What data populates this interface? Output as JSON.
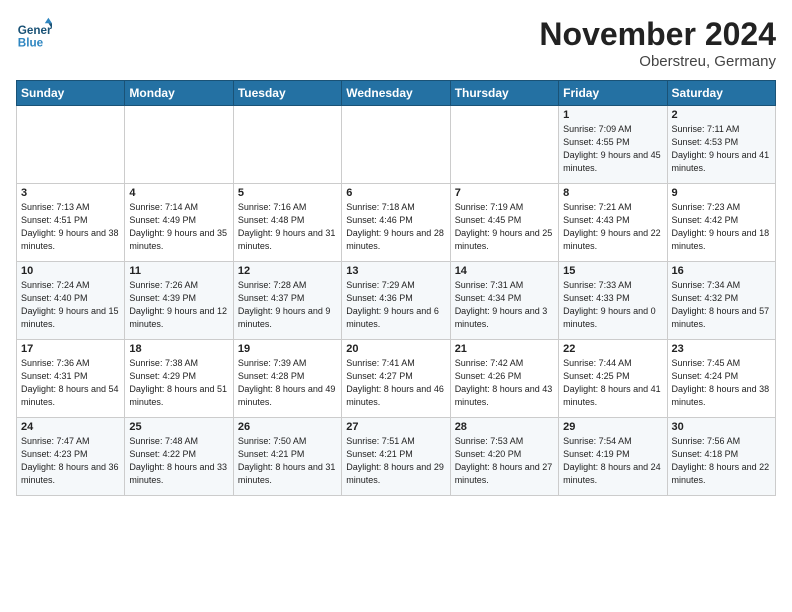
{
  "logo": {
    "line1": "General",
    "line2": "Blue"
  },
  "header": {
    "month": "November 2024",
    "location": "Oberstreu, Germany"
  },
  "weekdays": [
    "Sunday",
    "Monday",
    "Tuesday",
    "Wednesday",
    "Thursday",
    "Friday",
    "Saturday"
  ],
  "weeks": [
    [
      {
        "day": "",
        "info": ""
      },
      {
        "day": "",
        "info": ""
      },
      {
        "day": "",
        "info": ""
      },
      {
        "day": "",
        "info": ""
      },
      {
        "day": "",
        "info": ""
      },
      {
        "day": "1",
        "info": "Sunrise: 7:09 AM\nSunset: 4:55 PM\nDaylight: 9 hours\nand 45 minutes."
      },
      {
        "day": "2",
        "info": "Sunrise: 7:11 AM\nSunset: 4:53 PM\nDaylight: 9 hours\nand 41 minutes."
      }
    ],
    [
      {
        "day": "3",
        "info": "Sunrise: 7:13 AM\nSunset: 4:51 PM\nDaylight: 9 hours\nand 38 minutes."
      },
      {
        "day": "4",
        "info": "Sunrise: 7:14 AM\nSunset: 4:49 PM\nDaylight: 9 hours\nand 35 minutes."
      },
      {
        "day": "5",
        "info": "Sunrise: 7:16 AM\nSunset: 4:48 PM\nDaylight: 9 hours\nand 31 minutes."
      },
      {
        "day": "6",
        "info": "Sunrise: 7:18 AM\nSunset: 4:46 PM\nDaylight: 9 hours\nand 28 minutes."
      },
      {
        "day": "7",
        "info": "Sunrise: 7:19 AM\nSunset: 4:45 PM\nDaylight: 9 hours\nand 25 minutes."
      },
      {
        "day": "8",
        "info": "Sunrise: 7:21 AM\nSunset: 4:43 PM\nDaylight: 9 hours\nand 22 minutes."
      },
      {
        "day": "9",
        "info": "Sunrise: 7:23 AM\nSunset: 4:42 PM\nDaylight: 9 hours\nand 18 minutes."
      }
    ],
    [
      {
        "day": "10",
        "info": "Sunrise: 7:24 AM\nSunset: 4:40 PM\nDaylight: 9 hours\nand 15 minutes."
      },
      {
        "day": "11",
        "info": "Sunrise: 7:26 AM\nSunset: 4:39 PM\nDaylight: 9 hours\nand 12 minutes."
      },
      {
        "day": "12",
        "info": "Sunrise: 7:28 AM\nSunset: 4:37 PM\nDaylight: 9 hours\nand 9 minutes."
      },
      {
        "day": "13",
        "info": "Sunrise: 7:29 AM\nSunset: 4:36 PM\nDaylight: 9 hours\nand 6 minutes."
      },
      {
        "day": "14",
        "info": "Sunrise: 7:31 AM\nSunset: 4:34 PM\nDaylight: 9 hours\nand 3 minutes."
      },
      {
        "day": "15",
        "info": "Sunrise: 7:33 AM\nSunset: 4:33 PM\nDaylight: 9 hours\nand 0 minutes."
      },
      {
        "day": "16",
        "info": "Sunrise: 7:34 AM\nSunset: 4:32 PM\nDaylight: 8 hours\nand 57 minutes."
      }
    ],
    [
      {
        "day": "17",
        "info": "Sunrise: 7:36 AM\nSunset: 4:31 PM\nDaylight: 8 hours\nand 54 minutes."
      },
      {
        "day": "18",
        "info": "Sunrise: 7:38 AM\nSunset: 4:29 PM\nDaylight: 8 hours\nand 51 minutes."
      },
      {
        "day": "19",
        "info": "Sunrise: 7:39 AM\nSunset: 4:28 PM\nDaylight: 8 hours\nand 49 minutes."
      },
      {
        "day": "20",
        "info": "Sunrise: 7:41 AM\nSunset: 4:27 PM\nDaylight: 8 hours\nand 46 minutes."
      },
      {
        "day": "21",
        "info": "Sunrise: 7:42 AM\nSunset: 4:26 PM\nDaylight: 8 hours\nand 43 minutes."
      },
      {
        "day": "22",
        "info": "Sunrise: 7:44 AM\nSunset: 4:25 PM\nDaylight: 8 hours\nand 41 minutes."
      },
      {
        "day": "23",
        "info": "Sunrise: 7:45 AM\nSunset: 4:24 PM\nDaylight: 8 hours\nand 38 minutes."
      }
    ],
    [
      {
        "day": "24",
        "info": "Sunrise: 7:47 AM\nSunset: 4:23 PM\nDaylight: 8 hours\nand 36 minutes."
      },
      {
        "day": "25",
        "info": "Sunrise: 7:48 AM\nSunset: 4:22 PM\nDaylight: 8 hours\nand 33 minutes."
      },
      {
        "day": "26",
        "info": "Sunrise: 7:50 AM\nSunset: 4:21 PM\nDaylight: 8 hours\nand 31 minutes."
      },
      {
        "day": "27",
        "info": "Sunrise: 7:51 AM\nSunset: 4:21 PM\nDaylight: 8 hours\nand 29 minutes."
      },
      {
        "day": "28",
        "info": "Sunrise: 7:53 AM\nSunset: 4:20 PM\nDaylight: 8 hours\nand 27 minutes."
      },
      {
        "day": "29",
        "info": "Sunrise: 7:54 AM\nSunset: 4:19 PM\nDaylight: 8 hours\nand 24 minutes."
      },
      {
        "day": "30",
        "info": "Sunrise: 7:56 AM\nSunset: 4:18 PM\nDaylight: 8 hours\nand 22 minutes."
      }
    ]
  ]
}
